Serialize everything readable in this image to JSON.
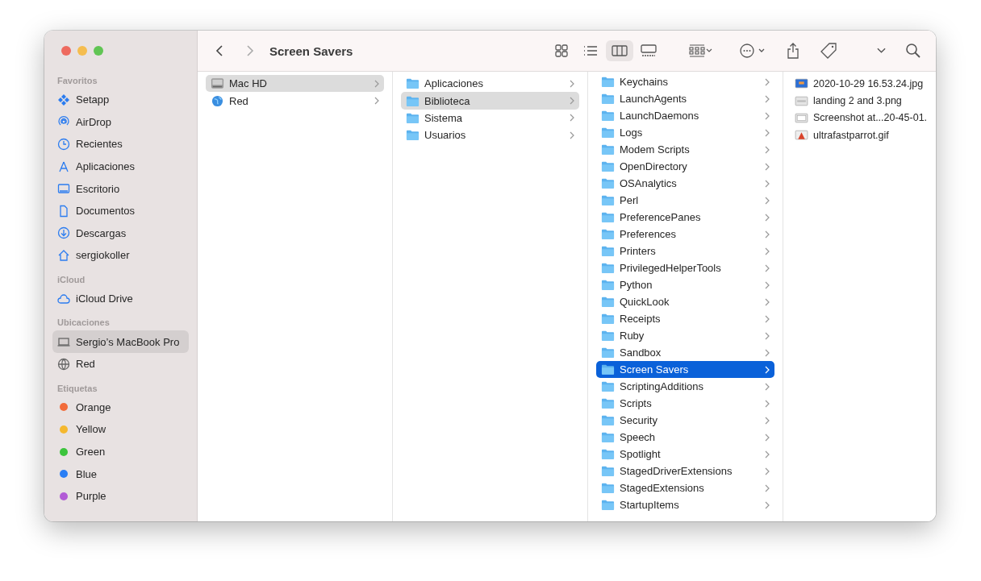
{
  "window": {
    "title": "Screen Savers"
  },
  "sidebar": {
    "sections": [
      {
        "title": "Favoritos",
        "items": [
          {
            "label": "Setapp",
            "selected": false
          },
          {
            "label": "AirDrop",
            "selected": false
          },
          {
            "label": "Recientes",
            "selected": false
          },
          {
            "label": "Aplicaciones",
            "selected": false
          },
          {
            "label": "Escritorio",
            "selected": false
          },
          {
            "label": "Documentos",
            "selected": false
          },
          {
            "label": "Descargas",
            "selected": false
          },
          {
            "label": "sergiokoller",
            "selected": false
          }
        ]
      },
      {
        "title": "iCloud",
        "items": [
          {
            "label": "iCloud Drive",
            "selected": false
          }
        ]
      },
      {
        "title": "Ubicaciones",
        "items": [
          {
            "label": "Sergio’s MacBook Pro",
            "selected": true
          },
          {
            "label": "Red",
            "selected": false
          }
        ]
      }
    ],
    "tags": {
      "title": "Etiquetas",
      "items": [
        {
          "label": "Orange",
          "color": "#f26b3a"
        },
        {
          "label": "Yellow",
          "color": "#f5b82e"
        },
        {
          "label": "Green",
          "color": "#3cc43c"
        },
        {
          "label": "Blue",
          "color": "#2a7ef5"
        },
        {
          "label": "Purple",
          "color": "#b25bd6"
        }
      ]
    }
  },
  "toolbar": {
    "views": [
      {
        "selected": false
      },
      {
        "selected": false
      },
      {
        "selected": true
      },
      {
        "selected": false
      }
    ]
  },
  "columns": [
    {
      "items": [
        {
          "kind": "disk",
          "name": "Mac HD",
          "selected": true,
          "focused": false
        },
        {
          "kind": "network",
          "name": "Red",
          "selected": false,
          "focused": false
        }
      ]
    },
    {
      "items": [
        {
          "kind": "folder",
          "name": "Aplicaciones",
          "selected": false,
          "focused": false
        },
        {
          "kind": "folder",
          "name": "Biblioteca",
          "selected": true,
          "focused": false
        },
        {
          "kind": "folder",
          "name": "Sistema",
          "selected": false,
          "focused": false
        },
        {
          "kind": "folder",
          "name": "Usuarios",
          "selected": false,
          "focused": false
        }
      ]
    },
    {
      "items": [
        {
          "kind": "folder",
          "name": "Keychains",
          "selected": false,
          "focused": false
        },
        {
          "kind": "folder",
          "name": "LaunchAgents",
          "selected": false,
          "focused": false
        },
        {
          "kind": "folder",
          "name": "LaunchDaemons",
          "selected": false,
          "focused": false
        },
        {
          "kind": "folder",
          "name": "Logs",
          "selected": false,
          "focused": false
        },
        {
          "kind": "folder",
          "name": "Modem Scripts",
          "selected": false,
          "focused": false
        },
        {
          "kind": "folder",
          "name": "OpenDirectory",
          "selected": false,
          "focused": false
        },
        {
          "kind": "folder",
          "name": "OSAnalytics",
          "selected": false,
          "focused": false
        },
        {
          "kind": "folder",
          "name": "Perl",
          "selected": false,
          "focused": false
        },
        {
          "kind": "folder",
          "name": "PreferencePanes",
          "selected": false,
          "focused": false
        },
        {
          "kind": "folder",
          "name": "Preferences",
          "selected": false,
          "focused": false
        },
        {
          "kind": "folder",
          "name": "Printers",
          "selected": false,
          "focused": false
        },
        {
          "kind": "folder",
          "name": "PrivilegedHelperTools",
          "selected": false,
          "focused": false
        },
        {
          "kind": "folder",
          "name": "Python",
          "selected": false,
          "focused": false
        },
        {
          "kind": "folder",
          "name": "QuickLook",
          "selected": false,
          "focused": false
        },
        {
          "kind": "folder",
          "name": "Receipts",
          "selected": false,
          "focused": false
        },
        {
          "kind": "folder",
          "name": "Ruby",
          "selected": false,
          "focused": false
        },
        {
          "kind": "folder",
          "name": "Sandbox",
          "selected": false,
          "focused": false
        },
        {
          "kind": "folder",
          "name": "Screen Savers",
          "selected": true,
          "focused": true
        },
        {
          "kind": "folder",
          "name": "ScriptingAdditions",
          "selected": false,
          "focused": false
        },
        {
          "kind": "folder",
          "name": "Scripts",
          "selected": false,
          "focused": false
        },
        {
          "kind": "folder",
          "name": "Security",
          "selected": false,
          "focused": false
        },
        {
          "kind": "folder",
          "name": "Speech",
          "selected": false,
          "focused": false
        },
        {
          "kind": "folder",
          "name": "Spotlight",
          "selected": false,
          "focused": false
        },
        {
          "kind": "folder",
          "name": "StagedDriverExtensions",
          "selected": false,
          "focused": false
        },
        {
          "kind": "folder",
          "name": "StagedExtensions",
          "selected": false,
          "focused": false
        },
        {
          "kind": "folder",
          "name": "StartupItems",
          "selected": false,
          "focused": false
        }
      ]
    },
    {
      "items": [
        {
          "kind": "image",
          "name": "2020-10-29 16.53.24.jpg",
          "selected": false,
          "focused": false
        },
        {
          "kind": "image",
          "name": "landing 2 and 3.png",
          "selected": false,
          "focused": false
        },
        {
          "kind": "image",
          "name": "Screenshot at...20-45-01.",
          "selected": false,
          "focused": false
        },
        {
          "kind": "image",
          "name": "ultrafastparrot.gif",
          "selected": false,
          "focused": false
        }
      ]
    }
  ]
}
